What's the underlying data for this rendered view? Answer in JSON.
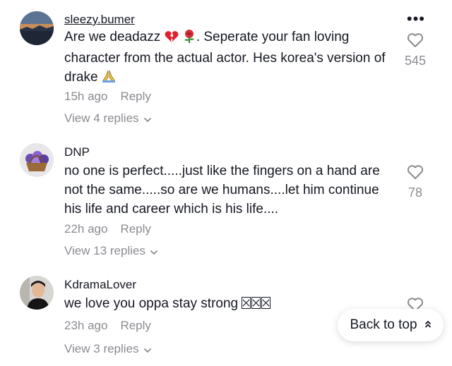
{
  "comments": [
    {
      "username": "sleezy.bumer",
      "text_before": "Are we deadazz",
      "text_after": ". Seperate your fan loving character from the actual actor. Hes korea's version of drake",
      "emoji_icons": [
        "broken-heart-icon",
        "rose-icon",
        "folded-hands-icon"
      ],
      "time": "15h ago",
      "reply_label": "Reply",
      "view_replies": "View 4 replies",
      "likes": "545"
    },
    {
      "username": "DNP",
      "text": "no one is perfect.....just like the fingers on a hand are not the same.....so are we humans....let him continue his life and career which is his life....",
      "time": "22h ago",
      "reply_label": "Reply",
      "view_replies": "View 13 replies",
      "likes": "78"
    },
    {
      "username": "KdramaLover",
      "text": "we love you oppa stay strong",
      "missing_glyphs": 3,
      "time": "23h ago",
      "reply_label": "Reply",
      "view_replies": "View 3 replies"
    }
  ],
  "back_to_top": "Back to top",
  "colors": {
    "primary_text": "#161823",
    "secondary_text": "#8a8b91",
    "heart_outline": "#8a8b91",
    "background": "#ffffff"
  }
}
